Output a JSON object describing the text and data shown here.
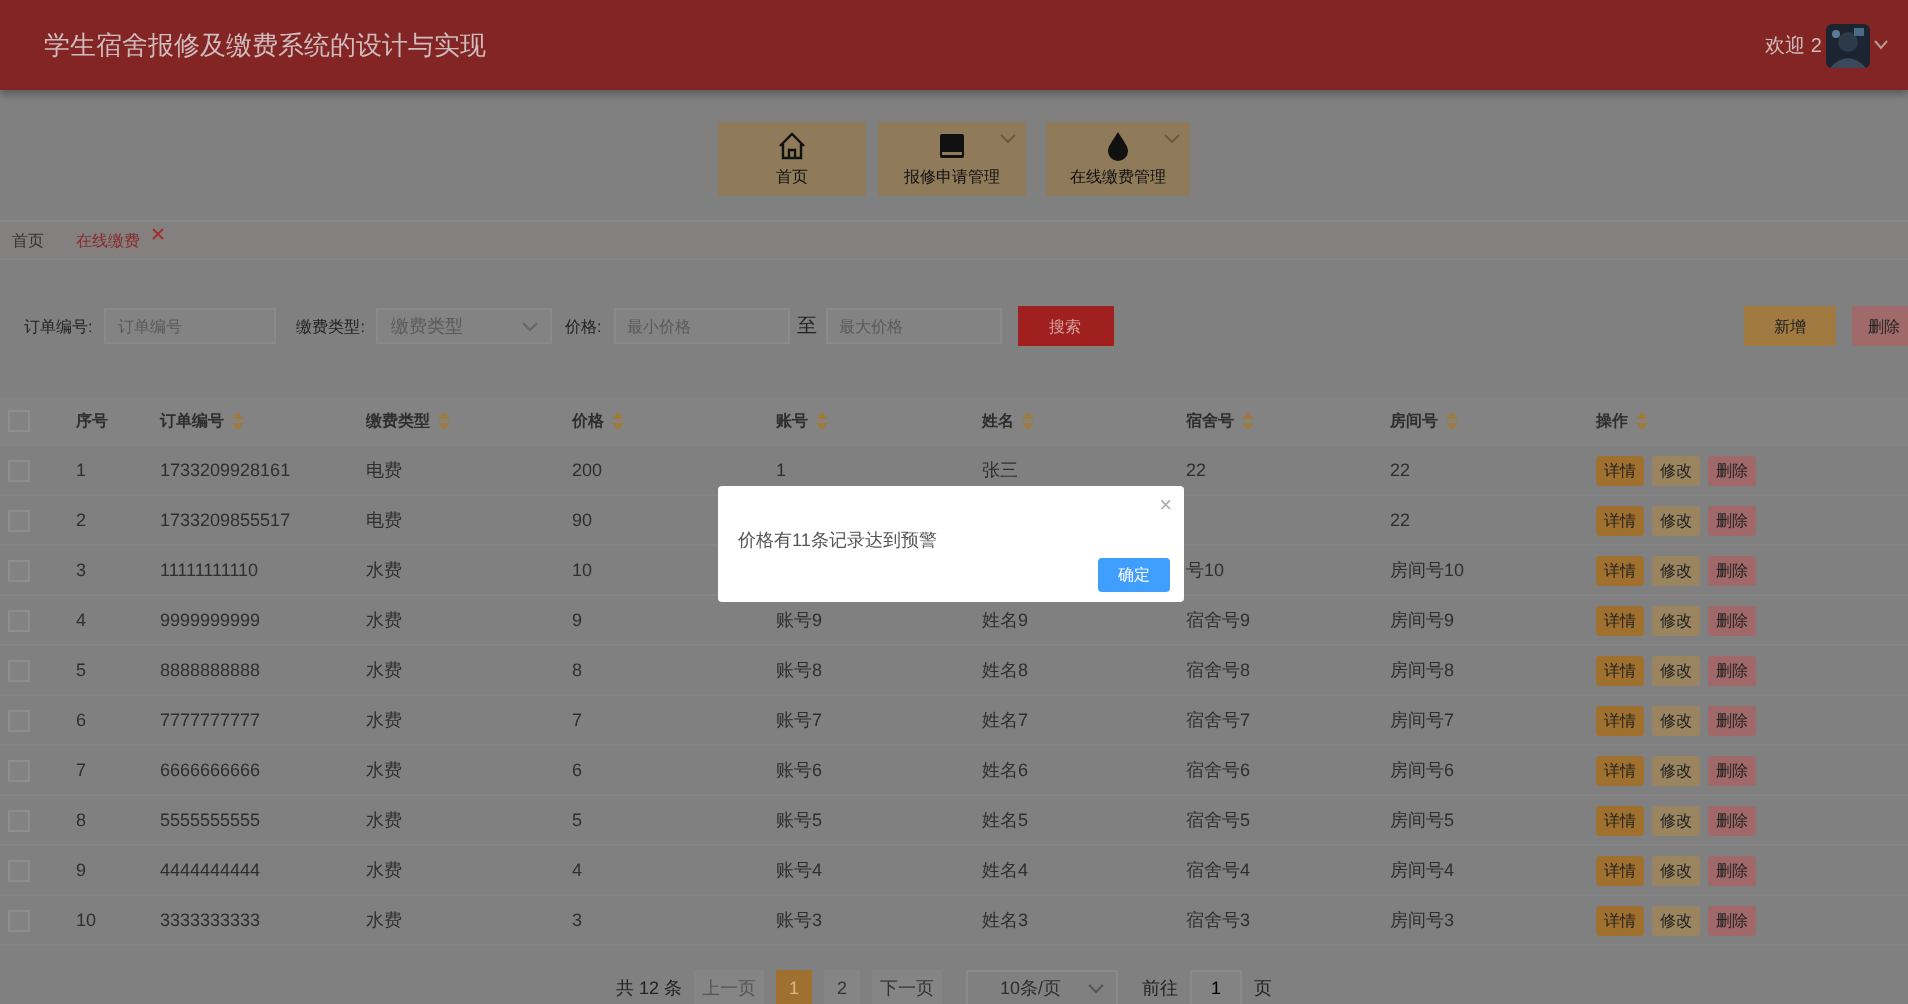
{
  "header": {
    "title": "学生宿舍报修及缴费系统的设计与实现",
    "greeting": "欢迎 2"
  },
  "nav": [
    {
      "label": "首页",
      "kind": "home",
      "dropdown": false
    },
    {
      "label": "报修申请管理",
      "kind": "drive",
      "dropdown": true
    },
    {
      "label": "在线缴费管理",
      "kind": "drop",
      "dropdown": true
    }
  ],
  "breadcrumb": [
    {
      "label": "首页",
      "selected": false,
      "closable": false
    },
    {
      "label": "在线缴费",
      "selected": true,
      "closable": true
    }
  ],
  "filters": {
    "order_label": "订单编号:",
    "order_placeholder": "订单编号",
    "type_label": "缴费类型:",
    "type_placeholder": "缴费类型",
    "price_label": "价格:",
    "min_placeholder": "最小价格",
    "to": "至",
    "max_placeholder": "最大价格",
    "search": "搜索"
  },
  "toolbar": [
    "新增",
    "删除"
  ],
  "table": {
    "all_checked": false,
    "columns": [
      {
        "label": "序号",
        "sortable": false
      },
      {
        "label": "订单编号",
        "sortable": true
      },
      {
        "label": "缴费类型",
        "sortable": true
      },
      {
        "label": "价格",
        "sortable": true
      },
      {
        "label": "账号",
        "sortable": true
      },
      {
        "label": "姓名",
        "sortable": true
      },
      {
        "label": "宿舍号",
        "sortable": true
      },
      {
        "label": "房间号",
        "sortable": true
      },
      {
        "label": "操作",
        "sortable": true
      }
    ],
    "rows": [
      {
        "checked": false,
        "cells": [
          "1",
          "1733209928161",
          "电费",
          "200",
          "1",
          "张三",
          "22",
          "22"
        ],
        "actions": [
          "详情",
          "修改",
          "删除"
        ]
      },
      {
        "checked": false,
        "cells": [
          "2",
          "1733209855517",
          "电费",
          "90",
          null,
          null,
          null,
          "22"
        ],
        "actions": [
          "详情",
          "修改",
          "删除"
        ]
      },
      {
        "checked": false,
        "cells": [
          "3",
          "11111111110",
          "水费",
          "10",
          null,
          null,
          "号10",
          "房间号10"
        ],
        "actions": [
          "详情",
          "修改",
          "删除"
        ]
      },
      {
        "checked": false,
        "cells": [
          "4",
          "9999999999",
          "水费",
          "9",
          "账号9",
          "姓名9",
          "宿舍号9",
          "房间号9"
        ],
        "actions": [
          "详情",
          "修改",
          "删除"
        ]
      },
      {
        "checked": false,
        "cells": [
          "5",
          "8888888888",
          "水费",
          "8",
          "账号8",
          "姓名8",
          "宿舍号8",
          "房间号8"
        ],
        "actions": [
          "详情",
          "修改",
          "删除"
        ]
      },
      {
        "checked": false,
        "cells": [
          "6",
          "7777777777",
          "水费",
          "7",
          "账号7",
          "姓名7",
          "宿舍号7",
          "房间号7"
        ],
        "actions": [
          "详情",
          "修改",
          "删除"
        ]
      },
      {
        "checked": false,
        "cells": [
          "7",
          "6666666666",
          "水费",
          "6",
          "账号6",
          "姓名6",
          "宿舍号6",
          "房间号6"
        ],
        "actions": [
          "详情",
          "修改",
          "删除"
        ]
      },
      {
        "checked": false,
        "cells": [
          "8",
          "5555555555",
          "水费",
          "5",
          "账号5",
          "姓名5",
          "宿舍号5",
          "房间号5"
        ],
        "actions": [
          "详情",
          "修改",
          "删除"
        ]
      },
      {
        "checked": false,
        "cells": [
          "9",
          "4444444444",
          "水费",
          "4",
          "账号4",
          "姓名4",
          "宿舍号4",
          "房间号4"
        ],
        "actions": [
          "详情",
          "修改",
          "删除"
        ]
      },
      {
        "checked": false,
        "cells": [
          "10",
          "3333333333",
          "水费",
          "3",
          "账号3",
          "姓名3",
          "宿舍号3",
          "房间号3"
        ],
        "actions": [
          "详情",
          "修改",
          "删除"
        ]
      }
    ]
  },
  "pagination": {
    "total": "共 12 条",
    "prev": "上一页",
    "pages": [
      {
        "label": "1",
        "selected": true
      },
      {
        "label": "2",
        "selected": false
      }
    ],
    "next": "下一页",
    "page_size": "10条/页",
    "goto": "前往",
    "goto_value": "1",
    "page_unit": "页"
  },
  "dialog": {
    "message": "价格有11条记录达到预警",
    "close": "×",
    "confirm": "确定"
  }
}
